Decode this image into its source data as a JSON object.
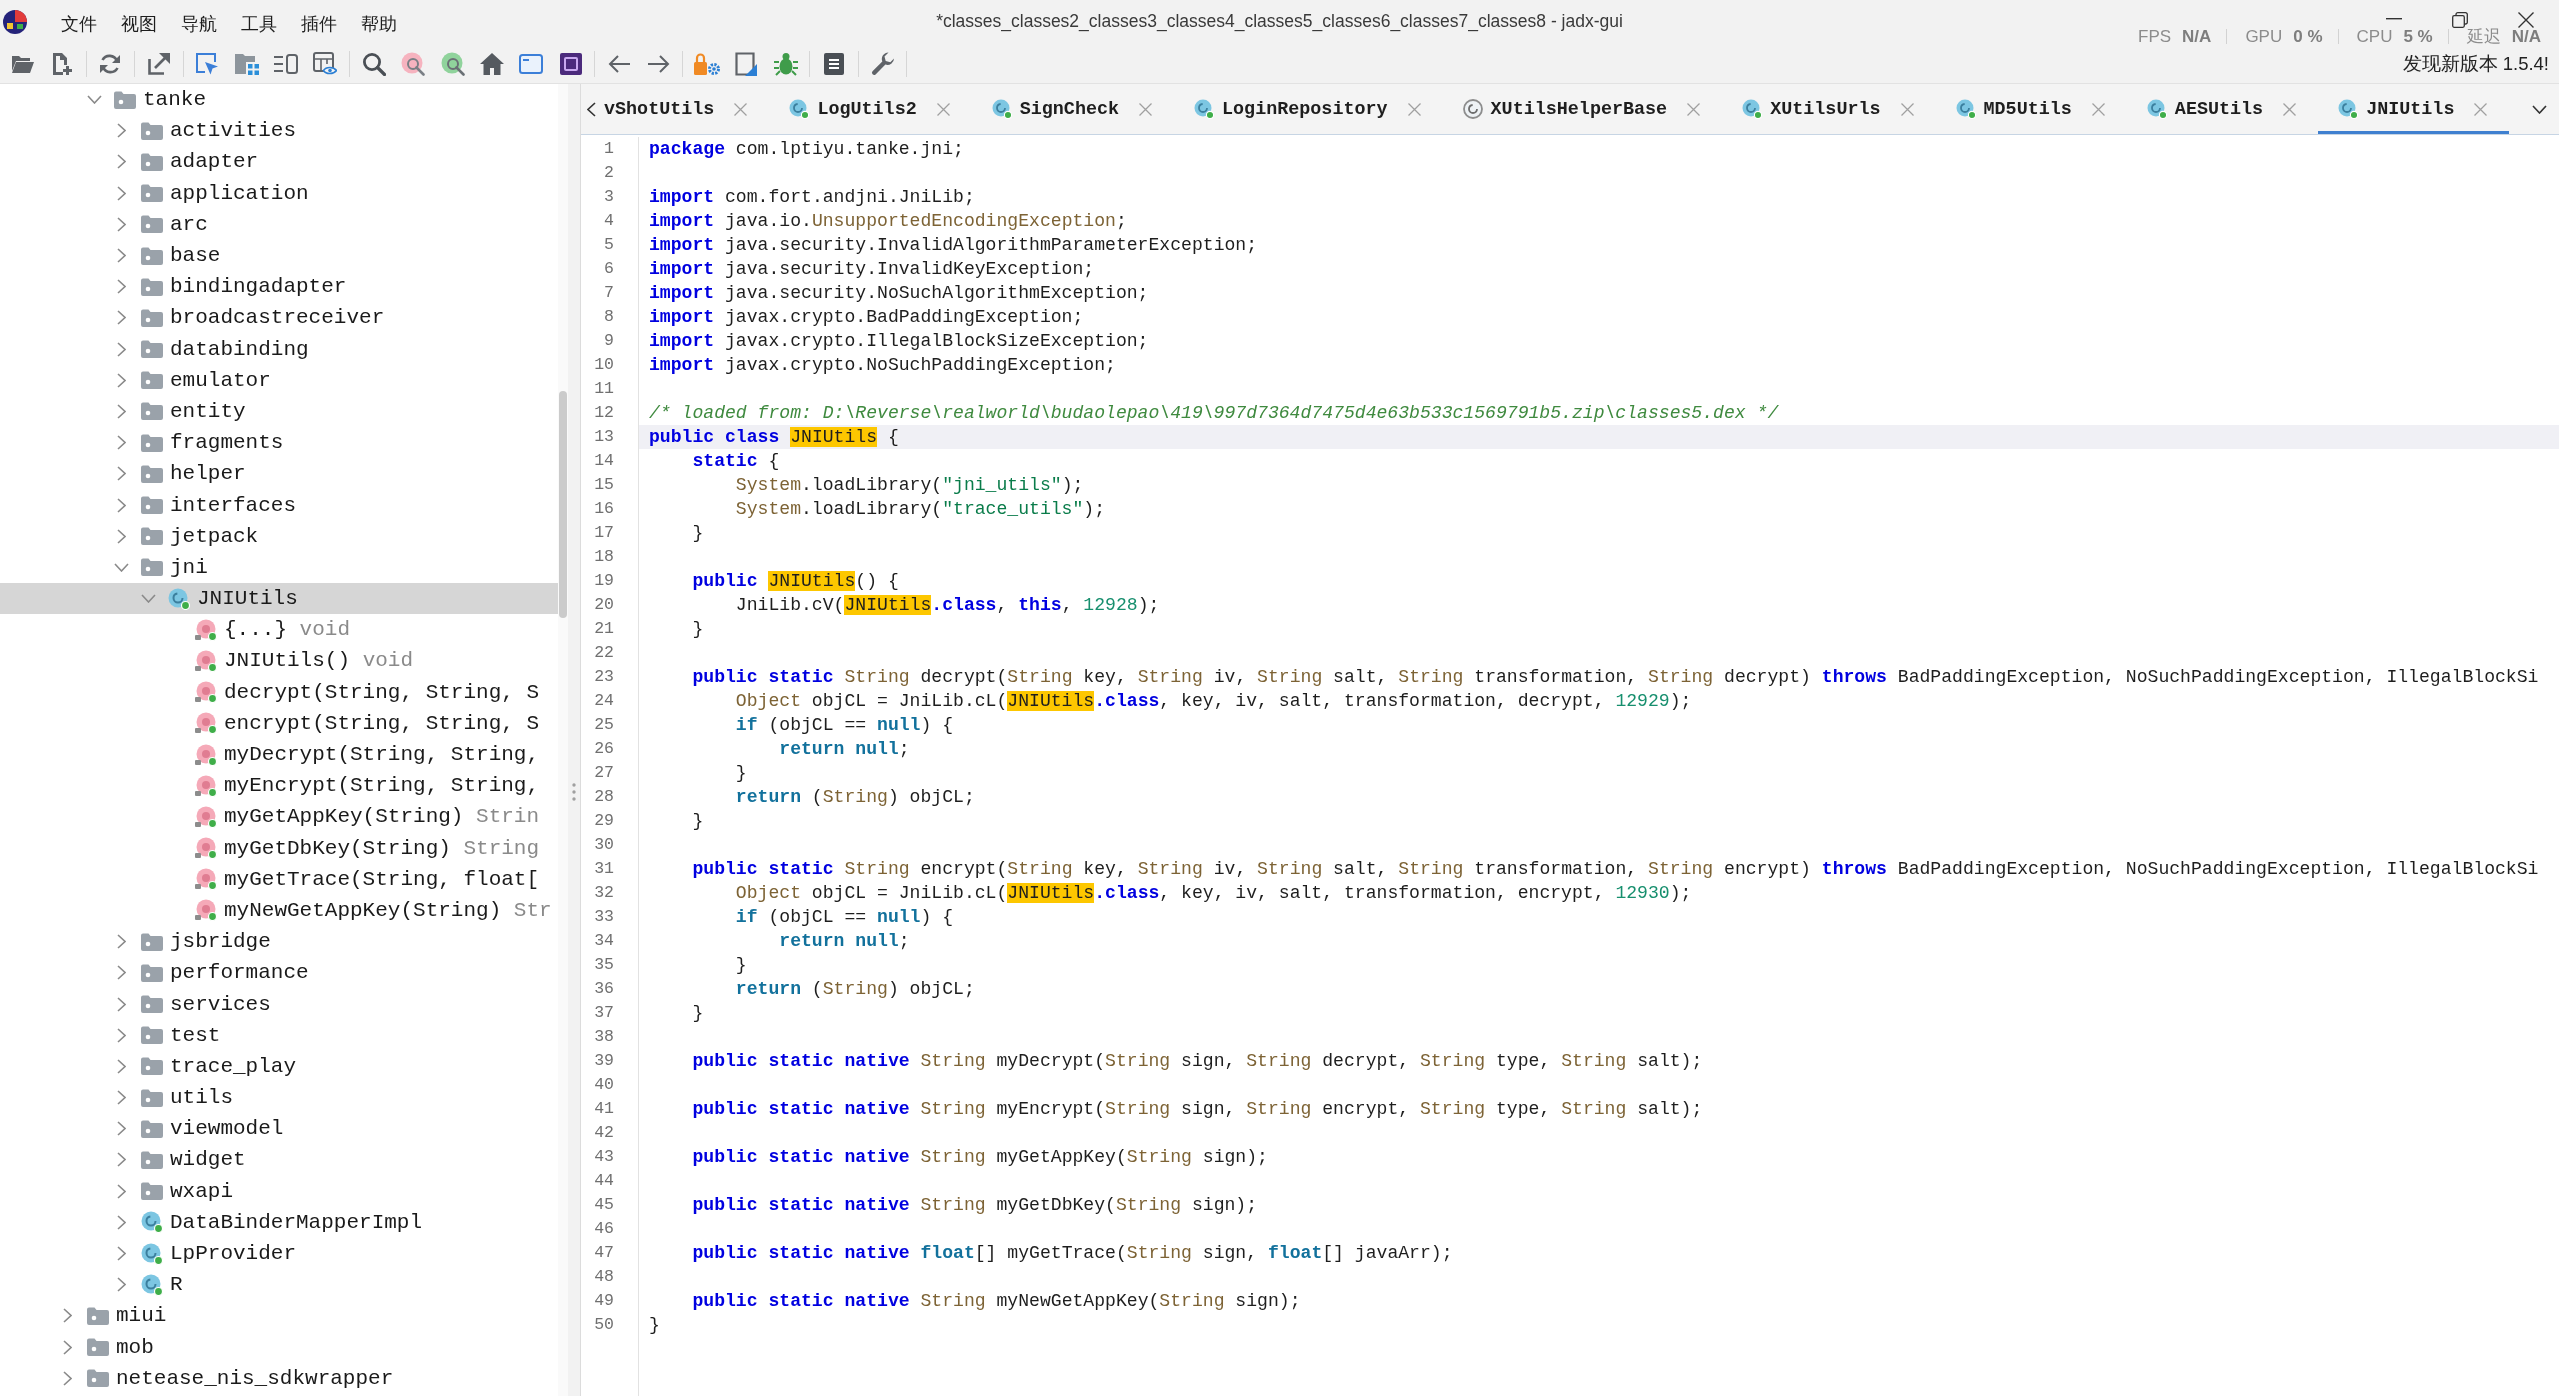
{
  "window": {
    "title": "*classes_classes2_classes3_classes4_classes5_classes6_classes7_classes8 - jadx-gui"
  },
  "menu_bar": {
    "items": [
      "文件",
      "视图",
      "导航",
      "工具",
      "插件",
      "帮助"
    ]
  },
  "performance_overlay": [
    {
      "label": "FPS",
      "value": "N/A"
    },
    {
      "label": "GPU",
      "value": "0 %"
    },
    {
      "label": "CPU",
      "value": "5 %"
    },
    {
      "label": "延迟",
      "value": "N/A"
    }
  ],
  "toolbar": {
    "update_notice": "发现新版本 1.5.4!"
  },
  "tree": {
    "partial_branch": {
      "children": [
        {
          "label": "tanke",
          "kind": "package",
          "expanded": true,
          "selected": false,
          "children": [
            {
              "label": "activities",
              "kind": "package",
              "expanded": false,
              "selected": false
            },
            {
              "label": "adapter",
              "kind": "package",
              "expanded": false,
              "selected": false
            },
            {
              "label": "application",
              "kind": "package",
              "expanded": false,
              "selected": false
            },
            {
              "label": "arc",
              "kind": "package",
              "expanded": false,
              "selected": false
            },
            {
              "label": "base",
              "kind": "package",
              "expanded": false,
              "selected": false
            },
            {
              "label": "bindingadapter",
              "kind": "package",
              "expanded": false,
              "selected": false
            },
            {
              "label": "broadcastreceiver",
              "kind": "package",
              "expanded": false,
              "selected": false
            },
            {
              "label": "databinding",
              "kind": "package",
              "expanded": false,
              "selected": false
            },
            {
              "label": "emulator",
              "kind": "package",
              "expanded": false,
              "selected": false
            },
            {
              "label": "entity",
              "kind": "package",
              "expanded": false,
              "selected": false
            },
            {
              "label": "fragments",
              "kind": "package",
              "expanded": false,
              "selected": false
            },
            {
              "label": "helper",
              "kind": "package",
              "expanded": false,
              "selected": false
            },
            {
              "label": "interfaces",
              "kind": "package",
              "expanded": false,
              "selected": false
            },
            {
              "label": "jetpack",
              "kind": "package",
              "expanded": false,
              "selected": false
            },
            {
              "label": "jni",
              "kind": "package",
              "expanded": true,
              "selected": false,
              "children": [
                {
                  "label": "JNIUtils",
                  "kind": "class",
                  "expanded": true,
                  "selected": true,
                  "children": [
                    {
                      "label": "{...}",
                      "kind": "method",
                      "return_type": "void",
                      "selected": false
                    },
                    {
                      "label": "JNIUtils()",
                      "kind": "method",
                      "return_type": "void",
                      "selected": false
                    },
                    {
                      "label": "decrypt(String, String, S",
                      "kind": "method",
                      "selected": false
                    },
                    {
                      "label": "encrypt(String, String, S",
                      "kind": "method",
                      "selected": false
                    },
                    {
                      "label": "myDecrypt(String, String,",
                      "kind": "method",
                      "selected": false
                    },
                    {
                      "label": "myEncrypt(String, String,",
                      "kind": "method",
                      "selected": false
                    },
                    {
                      "label": "myGetAppKey(String)",
                      "kind": "method",
                      "return_type": "Strin",
                      "selected": false
                    },
                    {
                      "label": "myGetDbKey(String)",
                      "kind": "method",
                      "return_type": "String",
                      "selected": false
                    },
                    {
                      "label": "myGetTrace(String, float[",
                      "kind": "method",
                      "selected": false
                    },
                    {
                      "label": "myNewGetAppKey(String)",
                      "kind": "method",
                      "return_type": "Str",
                      "selected": false
                    }
                  ]
                }
              ]
            },
            {
              "label": "jsbridge",
              "kind": "package",
              "expanded": false,
              "selected": false
            },
            {
              "label": "performance",
              "kind": "package",
              "expanded": false,
              "selected": false
            },
            {
              "label": "services",
              "kind": "package",
              "expanded": false,
              "selected": false
            },
            {
              "label": "test",
              "kind": "package",
              "expanded": false,
              "selected": false
            },
            {
              "label": "trace_play",
              "kind": "package",
              "expanded": false,
              "selected": false
            },
            {
              "label": "utils",
              "kind": "package",
              "expanded": false,
              "selected": false
            },
            {
              "label": "viewmodel",
              "kind": "package",
              "expanded": false,
              "selected": false
            },
            {
              "label": "widget",
              "kind": "package",
              "expanded": false,
              "selected": false
            },
            {
              "label": "wxapi",
              "kind": "package",
              "expanded": false,
              "selected": false
            },
            {
              "label": "DataBinderMapperImpl",
              "kind": "class",
              "expanded": false,
              "selected": false
            },
            {
              "label": "LpProvider",
              "kind": "class",
              "expanded": false,
              "selected": false
            },
            {
              "label": "R",
              "kind": "class",
              "expanded": false,
              "selected": false
            }
          ]
        }
      ]
    },
    "items": [
      {
        "label": "miui",
        "kind": "package",
        "expanded": false,
        "selected": false
      },
      {
        "label": "mob",
        "kind": "package",
        "expanded": false,
        "selected": false
      },
      {
        "label": "netease_nis_sdkwrapper",
        "kind": "package",
        "expanded": false,
        "selected": false
      }
    ]
  },
  "tabs": [
    {
      "label": "vShotUtils",
      "kind": "clipped",
      "selected": false
    },
    {
      "label": "LogUtils2",
      "kind": "class",
      "selected": false
    },
    {
      "label": "SignCheck",
      "kind": "class",
      "selected": false
    },
    {
      "label": "LoginRepository",
      "kind": "class",
      "selected": false
    },
    {
      "label": "XUtilsHelperBase",
      "kind": "abstract_class",
      "selected": false
    },
    {
      "label": "XUtilsUrls",
      "kind": "class",
      "selected": false
    },
    {
      "label": "MD5Utils",
      "kind": "class",
      "selected": false
    },
    {
      "label": "AESUtils",
      "kind": "class",
      "selected": false
    },
    {
      "label": "JNIUtils",
      "kind": "class",
      "selected": true
    }
  ],
  "editor": {
    "lines": [
      {
        "number": "1",
        "current": false,
        "tokens": [
          {
            "kind": "keyword",
            "text": "package"
          },
          {
            "kind": "plain",
            "text": " com.lptiyu.tanke.jni;"
          }
        ]
      },
      {
        "number": "2",
        "current": false
      },
      {
        "number": "3",
        "current": false,
        "tokens": [
          {
            "kind": "keyword",
            "text": "import"
          },
          {
            "kind": "plain",
            "text": " com.fort.andjni.JniLib;"
          }
        ]
      },
      {
        "number": "4",
        "current": false,
        "tokens": [
          {
            "kind": "keyword",
            "text": "import"
          },
          {
            "kind": "plain",
            "text": " java.io."
          },
          {
            "kind": "type",
            "text": "UnsupportedEncodingException"
          },
          {
            "kind": "plain",
            "text": ";"
          }
        ]
      },
      {
        "number": "5",
        "current": false,
        "tokens": [
          {
            "kind": "keyword",
            "text": "import"
          },
          {
            "kind": "plain",
            "text": " java.security.InvalidAlgorithmParameterException;"
          }
        ]
      },
      {
        "number": "6",
        "current": false,
        "tokens": [
          {
            "kind": "keyword",
            "text": "import"
          },
          {
            "kind": "plain",
            "text": " java.security.InvalidKeyException;"
          }
        ]
      },
      {
        "number": "7",
        "current": false,
        "tokens": [
          {
            "kind": "keyword",
            "text": "import"
          },
          {
            "kind": "plain",
            "text": " java.security.NoSuchAlgorithmException;"
          }
        ]
      },
      {
        "number": "8",
        "current": false,
        "tokens": [
          {
            "kind": "keyword",
            "text": "import"
          },
          {
            "kind": "plain",
            "text": " javax.crypto.BadPaddingException;"
          }
        ]
      },
      {
        "number": "9",
        "current": false,
        "tokens": [
          {
            "kind": "keyword",
            "text": "import"
          },
          {
            "kind": "plain",
            "text": " javax.crypto.IllegalBlockSizeException;"
          }
        ]
      },
      {
        "number": "10",
        "current": false,
        "tokens": [
          {
            "kind": "keyword",
            "text": "import"
          },
          {
            "kind": "plain",
            "text": " javax.crypto.NoSuchPaddingException;"
          }
        ]
      },
      {
        "number": "11",
        "current": false
      },
      {
        "number": "12",
        "current": false,
        "tokens": [
          {
            "kind": "comment",
            "text": "/* loaded from: D:\\Reverse\\realworld\\budaolepao\\419\\997d7364d7475d4e63b533c1569791b5.zip\\classes5.dex */"
          }
        ]
      },
      {
        "number": "13",
        "current": true,
        "tokens": [
          {
            "kind": "keyword",
            "text": "public "
          },
          {
            "kind": "keyword",
            "text": "class "
          },
          {
            "kind": "caret"
          },
          {
            "kind": "match",
            "text": "JNIUtils"
          },
          {
            "kind": "plain",
            "text": " {"
          }
        ]
      },
      {
        "number": "14",
        "current": false,
        "tokens": [
          {
            "kind": "keyword",
            "text": "    static"
          },
          {
            "kind": "plain",
            "text": " {"
          }
        ]
      },
      {
        "number": "15",
        "current": false,
        "tokens": [
          {
            "kind": "type",
            "text": "        System"
          },
          {
            "kind": "plain",
            "text": ".loadLibrary("
          },
          {
            "kind": "string",
            "text": "\"jni_utils\""
          },
          {
            "kind": "plain",
            "text": ");"
          }
        ]
      },
      {
        "number": "16",
        "current": false,
        "tokens": [
          {
            "kind": "type",
            "text": "        System"
          },
          {
            "kind": "plain",
            "text": ".loadLibrary("
          },
          {
            "kind": "string",
            "text": "\"trace_utils\""
          },
          {
            "kind": "plain",
            "text": ");"
          }
        ]
      },
      {
        "number": "17",
        "current": false,
        "tokens": [
          {
            "kind": "plain",
            "text": "    }"
          }
        ]
      },
      {
        "number": "18",
        "current": false
      },
      {
        "number": "19",
        "current": false,
        "tokens": [
          {
            "kind": "keyword",
            "text": "    public "
          },
          {
            "kind": "match",
            "text": "JNIUtils"
          },
          {
            "kind": "plain",
            "text": "() {"
          }
        ]
      },
      {
        "number": "20",
        "current": false,
        "tokens": [
          {
            "kind": "plain",
            "text": "        JniLib.cV("
          },
          {
            "kind": "match",
            "text": "JNIUtils"
          },
          {
            "kind": "keyword",
            "text": ".class"
          },
          {
            "kind": "plain",
            "text": ", "
          },
          {
            "kind": "keyword",
            "text": "this"
          },
          {
            "kind": "plain",
            "text": ", "
          },
          {
            "kind": "number",
            "text": "12928"
          },
          {
            "kind": "plain",
            "text": ");"
          }
        ]
      },
      {
        "number": "21",
        "current": false,
        "tokens": [
          {
            "kind": "plain",
            "text": "    }"
          }
        ]
      },
      {
        "number": "22",
        "current": false
      },
      {
        "number": "23",
        "current": false,
        "tokens": [
          {
            "kind": "keyword",
            "text": "    public "
          },
          {
            "kind": "keyword",
            "text": "static "
          },
          {
            "kind": "type",
            "text": "String"
          },
          {
            "kind": "plain",
            "text": " decrypt("
          },
          {
            "kind": "type",
            "text": "String"
          },
          {
            "kind": "plain",
            "text": " key, "
          },
          {
            "kind": "type",
            "text": "String"
          },
          {
            "kind": "plain",
            "text": " iv, "
          },
          {
            "kind": "type",
            "text": "String"
          },
          {
            "kind": "plain",
            "text": " salt, "
          },
          {
            "kind": "type",
            "text": "String"
          },
          {
            "kind": "plain",
            "text": " transformation, "
          },
          {
            "kind": "type",
            "text": "String"
          },
          {
            "kind": "plain",
            "text": " decrypt) "
          },
          {
            "kind": "keyword",
            "text": "throws"
          },
          {
            "kind": "plain",
            "text": " BadPaddingException, NoSuchPaddingException, IllegalBlockSi"
          }
        ]
      },
      {
        "number": "24",
        "current": false,
        "tokens": [
          {
            "kind": "type",
            "text": "        Object"
          },
          {
            "kind": "plain",
            "text": " objCL = JniLib.cL("
          },
          {
            "kind": "match",
            "text": "JNIUtils"
          },
          {
            "kind": "keyword",
            "text": ".class"
          },
          {
            "kind": "plain",
            "text": ", key, iv, salt, transformation, decrypt, "
          },
          {
            "kind": "number",
            "text": "12929"
          },
          {
            "kind": "plain",
            "text": ");"
          }
        ]
      },
      {
        "number": "25",
        "current": false,
        "tokens": [
          {
            "kind": "control",
            "text": "        if"
          },
          {
            "kind": "plain",
            "text": " (objCL == "
          },
          {
            "kind": "control",
            "text": "null"
          },
          {
            "kind": "plain",
            "text": ") {"
          }
        ]
      },
      {
        "number": "26",
        "current": false,
        "tokens": [
          {
            "kind": "control",
            "text": "            return "
          },
          {
            "kind": "control",
            "text": "null"
          },
          {
            "kind": "plain",
            "text": ";"
          }
        ]
      },
      {
        "number": "27",
        "current": false,
        "tokens": [
          {
            "kind": "plain",
            "text": "        }"
          }
        ]
      },
      {
        "number": "28",
        "current": false,
        "tokens": [
          {
            "kind": "control",
            "text": "        return"
          },
          {
            "kind": "plain",
            "text": " ("
          },
          {
            "kind": "type",
            "text": "String"
          },
          {
            "kind": "plain",
            "text": ") objCL;"
          }
        ]
      },
      {
        "number": "29",
        "current": false,
        "tokens": [
          {
            "kind": "plain",
            "text": "    }"
          }
        ]
      },
      {
        "number": "30",
        "current": false
      },
      {
        "number": "31",
        "current": false,
        "tokens": [
          {
            "kind": "keyword",
            "text": "    public "
          },
          {
            "kind": "keyword",
            "text": "static "
          },
          {
            "kind": "type",
            "text": "String"
          },
          {
            "kind": "plain",
            "text": " encrypt("
          },
          {
            "kind": "type",
            "text": "String"
          },
          {
            "kind": "plain",
            "text": " key, "
          },
          {
            "kind": "type",
            "text": "String"
          },
          {
            "kind": "plain",
            "text": " iv, "
          },
          {
            "kind": "type",
            "text": "String"
          },
          {
            "kind": "plain",
            "text": " salt, "
          },
          {
            "kind": "type",
            "text": "String"
          },
          {
            "kind": "plain",
            "text": " transformation, "
          },
          {
            "kind": "type",
            "text": "String"
          },
          {
            "kind": "plain",
            "text": " encrypt) "
          },
          {
            "kind": "keyword",
            "text": "throws"
          },
          {
            "kind": "plain",
            "text": " BadPaddingException, NoSuchPaddingException, IllegalBlockSi"
          }
        ]
      },
      {
        "number": "32",
        "current": false,
        "tokens": [
          {
            "kind": "type",
            "text": "        Object"
          },
          {
            "kind": "plain",
            "text": " objCL = JniLib.cL("
          },
          {
            "kind": "match",
            "text": "JNIUtils"
          },
          {
            "kind": "keyword",
            "text": ".class"
          },
          {
            "kind": "plain",
            "text": ", key, iv, salt, transformation, encrypt, "
          },
          {
            "kind": "number",
            "text": "12930"
          },
          {
            "kind": "plain",
            "text": ");"
          }
        ]
      },
      {
        "number": "33",
        "current": false,
        "tokens": [
          {
            "kind": "control",
            "text": "        if"
          },
          {
            "kind": "plain",
            "text": " (objCL == "
          },
          {
            "kind": "control",
            "text": "null"
          },
          {
            "kind": "plain",
            "text": ") {"
          }
        ]
      },
      {
        "number": "34",
        "current": false,
        "tokens": [
          {
            "kind": "control",
            "text": "            return "
          },
          {
            "kind": "control",
            "text": "null"
          },
          {
            "kind": "plain",
            "text": ";"
          }
        ]
      },
      {
        "number": "35",
        "current": false,
        "tokens": [
          {
            "kind": "plain",
            "text": "        }"
          }
        ]
      },
      {
        "number": "36",
        "current": false,
        "tokens": [
          {
            "kind": "control",
            "text": "        return"
          },
          {
            "kind": "plain",
            "text": " ("
          },
          {
            "kind": "type",
            "text": "String"
          },
          {
            "kind": "plain",
            "text": ") objCL;"
          }
        ]
      },
      {
        "number": "37",
        "current": false,
        "tokens": [
          {
            "kind": "plain",
            "text": "    }"
          }
        ]
      },
      {
        "number": "38",
        "current": false
      },
      {
        "number": "39",
        "current": false,
        "tokens": [
          {
            "kind": "keyword",
            "text": "    public "
          },
          {
            "kind": "keyword",
            "text": "static "
          },
          {
            "kind": "keyword",
            "text": "native "
          },
          {
            "kind": "type",
            "text": "String"
          },
          {
            "kind": "plain",
            "text": " myDecrypt("
          },
          {
            "kind": "type",
            "text": "String"
          },
          {
            "kind": "plain",
            "text": " sign, "
          },
          {
            "kind": "type",
            "text": "String"
          },
          {
            "kind": "plain",
            "text": " decrypt, "
          },
          {
            "kind": "type",
            "text": "String"
          },
          {
            "kind": "plain",
            "text": " type, "
          },
          {
            "kind": "type",
            "text": "String"
          },
          {
            "kind": "plain",
            "text": " salt);"
          }
        ]
      },
      {
        "number": "40",
        "current": false
      },
      {
        "number": "41",
        "current": false,
        "tokens": [
          {
            "kind": "keyword",
            "text": "    public "
          },
          {
            "kind": "keyword",
            "text": "static "
          },
          {
            "kind": "keyword",
            "text": "native "
          },
          {
            "kind": "type",
            "text": "String"
          },
          {
            "kind": "plain",
            "text": " myEncrypt("
          },
          {
            "kind": "type",
            "text": "String"
          },
          {
            "kind": "plain",
            "text": " sign, "
          },
          {
            "kind": "type",
            "text": "String"
          },
          {
            "kind": "plain",
            "text": " encrypt, "
          },
          {
            "kind": "type",
            "text": "String"
          },
          {
            "kind": "plain",
            "text": " type, "
          },
          {
            "kind": "type",
            "text": "String"
          },
          {
            "kind": "plain",
            "text": " salt);"
          }
        ]
      },
      {
        "number": "42",
        "current": false
      },
      {
        "number": "43",
        "current": false,
        "tokens": [
          {
            "kind": "keyword",
            "text": "    public "
          },
          {
            "kind": "keyword",
            "text": "static "
          },
          {
            "kind": "keyword",
            "text": "native "
          },
          {
            "kind": "type",
            "text": "String"
          },
          {
            "kind": "plain",
            "text": " myGetAppKey("
          },
          {
            "kind": "type",
            "text": "String"
          },
          {
            "kind": "plain",
            "text": " sign);"
          }
        ]
      },
      {
        "number": "44",
        "current": false
      },
      {
        "number": "45",
        "current": false,
        "tokens": [
          {
            "kind": "keyword",
            "text": "    public "
          },
          {
            "kind": "keyword",
            "text": "static "
          },
          {
            "kind": "keyword",
            "text": "native "
          },
          {
            "kind": "type",
            "text": "String"
          },
          {
            "kind": "plain",
            "text": " myGetDbKey("
          },
          {
            "kind": "type",
            "text": "String"
          },
          {
            "kind": "plain",
            "text": " sign);"
          }
        ]
      },
      {
        "number": "46",
        "current": false
      },
      {
        "number": "47",
        "current": false,
        "tokens": [
          {
            "kind": "keyword",
            "text": "    public "
          },
          {
            "kind": "keyword",
            "text": "static "
          },
          {
            "kind": "keyword",
            "text": "native "
          },
          {
            "kind": "control",
            "text": "float"
          },
          {
            "kind": "plain",
            "text": "[] myGetTrace("
          },
          {
            "kind": "type",
            "text": "String"
          },
          {
            "kind": "plain",
            "text": " sign, "
          },
          {
            "kind": "control",
            "text": "float"
          },
          {
            "kind": "plain",
            "text": "[] javaArr);"
          }
        ]
      },
      {
        "number": "48",
        "current": false
      },
      {
        "number": "49",
        "current": false,
        "tokens": [
          {
            "kind": "keyword",
            "text": "    public "
          },
          {
            "kind": "keyword",
            "text": "static "
          },
          {
            "kind": "keyword",
            "text": "native "
          },
          {
            "kind": "type",
            "text": "String"
          },
          {
            "kind": "plain",
            "text": " myNewGetAppKey("
          },
          {
            "kind": "type",
            "text": "String"
          },
          {
            "kind": "plain",
            "text": " sign);"
          }
        ]
      },
      {
        "number": "50",
        "current": false,
        "tokens": [
          {
            "kind": "plain",
            "text": "}"
          }
        ]
      }
    ]
  }
}
